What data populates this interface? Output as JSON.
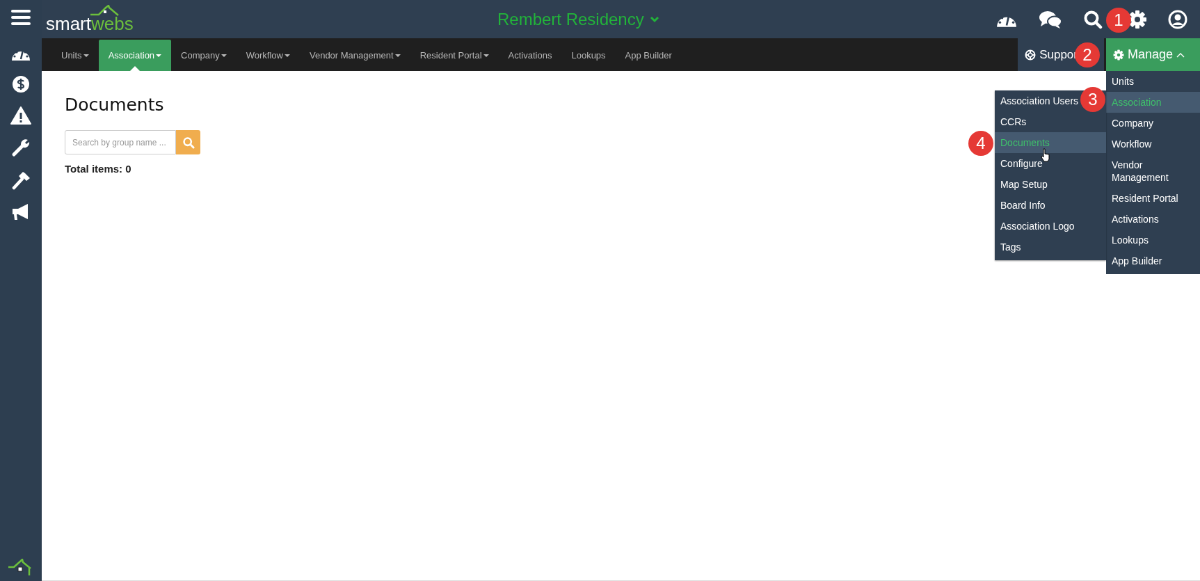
{
  "header": {
    "logo": {
      "part_1": "smart",
      "part_2": "webs"
    },
    "title": "Rembert Residency"
  },
  "nav": [
    {
      "label": "Units",
      "caret": true,
      "selected": false
    },
    {
      "label": "Association",
      "caret": true,
      "selected": true
    },
    {
      "label": "Company",
      "caret": true,
      "selected": false
    },
    {
      "label": "Workflow",
      "caret": true,
      "selected": false
    },
    {
      "label": "Vendor Management",
      "caret": true,
      "selected": false
    },
    {
      "label": "Resident Portal",
      "caret": true,
      "selected": false
    },
    {
      "label": "Activations",
      "caret": false,
      "selected": false
    },
    {
      "label": "Lookups",
      "caret": false,
      "selected": false
    },
    {
      "label": "App Builder",
      "caret": false,
      "selected": false
    }
  ],
  "support_button": {
    "label": "Suppor"
  },
  "manage_button": {
    "label": "Manage",
    "expanded": true
  },
  "manage_menu": [
    {
      "label": "Units",
      "selected": false
    },
    {
      "label": "Association",
      "selected": true
    },
    {
      "label": "Company",
      "selected": false
    },
    {
      "label": "Workflow",
      "selected": false
    },
    {
      "label": "Vendor Management",
      "selected": false
    },
    {
      "label": "Resident Portal",
      "selected": false
    },
    {
      "label": "Activations",
      "selected": false
    },
    {
      "label": "Lookups",
      "selected": false
    },
    {
      "label": "App Builder",
      "selected": false
    }
  ],
  "association_menu": [
    {
      "label": "Association Users",
      "selected": false
    },
    {
      "label": "CCRs",
      "selected": false
    },
    {
      "label": "Documents",
      "selected": true
    },
    {
      "label": "Configure",
      "selected": false
    },
    {
      "label": "Map Setup",
      "selected": false
    },
    {
      "label": "Board Info",
      "selected": false
    },
    {
      "label": "Association Logo",
      "selected": false
    },
    {
      "label": "Tags",
      "selected": false
    }
  ],
  "page": {
    "title": "Documents",
    "search": {
      "placeholder": "Search by group name ..."
    },
    "total": "Total items: 0"
  },
  "callouts": [
    "1",
    "2",
    "3",
    "4"
  ]
}
